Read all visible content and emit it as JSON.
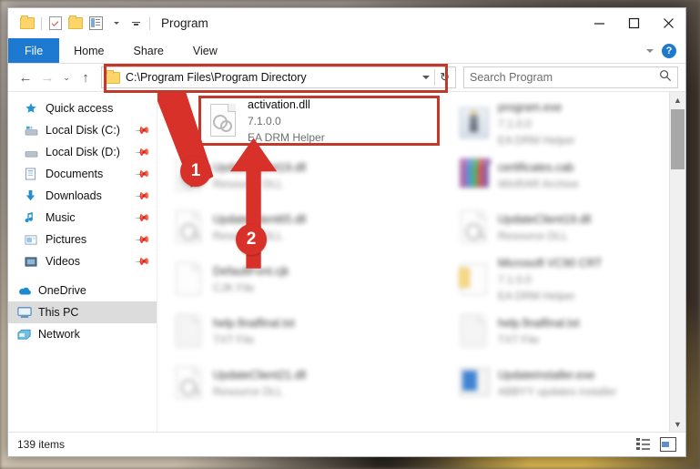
{
  "window": {
    "title": "Program",
    "quick_access": [
      "folder-icon",
      "properties-checkbox-icon",
      "new-folder-icon",
      "properties-icon",
      "customize-qat-icon"
    ],
    "controls": {
      "minimize": "minimize-icon",
      "maximize": "maximize-icon",
      "close": "close-icon"
    }
  },
  "ribbon": {
    "tabs": [
      {
        "label": "File",
        "active": true
      },
      {
        "label": "Home",
        "active": false
      },
      {
        "label": "Share",
        "active": false
      },
      {
        "label": "View",
        "active": false
      }
    ],
    "collapse_icon": "chevron-down-icon",
    "help_label": "?"
  },
  "addressbar": {
    "back": "back-arrow-icon",
    "forward": "forward-arrow-icon",
    "recent": "chevron-down-icon",
    "up": "up-arrow-icon",
    "path": "C:\\Program Files\\Program Directory",
    "dropdown": "chevron-down-icon",
    "refresh": "↻",
    "highlight_color": "#c0392b"
  },
  "search": {
    "placeholder": "Search Program",
    "icon": "search-icon"
  },
  "sidebar": {
    "items": [
      {
        "label": "Quick access",
        "icon": "star-icon",
        "pinned": false,
        "selected": false,
        "group": "top"
      },
      {
        "label": "Local Disk (C:)",
        "icon": "drive-icon",
        "pinned": true,
        "selected": false,
        "group": "top"
      },
      {
        "label": "Local Disk (D:)",
        "icon": "drive-icon",
        "pinned": true,
        "selected": false,
        "group": "top"
      },
      {
        "label": "Documents",
        "icon": "documents-icon",
        "pinned": true,
        "selected": false,
        "group": "top"
      },
      {
        "label": "Downloads",
        "icon": "downloads-icon",
        "pinned": true,
        "selected": false,
        "group": "top"
      },
      {
        "label": "Music",
        "icon": "music-icon",
        "pinned": true,
        "selected": false,
        "group": "top"
      },
      {
        "label": "Pictures",
        "icon": "pictures-icon",
        "pinned": true,
        "selected": false,
        "group": "top"
      },
      {
        "label": "Videos",
        "icon": "videos-icon",
        "pinned": true,
        "selected": false,
        "group": "top"
      },
      {
        "label": "OneDrive",
        "icon": "onedrive-icon",
        "pinned": false,
        "selected": false,
        "group": "root"
      },
      {
        "label": "This PC",
        "icon": "this-pc-icon",
        "pinned": false,
        "selected": true,
        "group": "root"
      },
      {
        "label": "Network",
        "icon": "network-icon",
        "pinned": false,
        "selected": false,
        "group": "root"
      }
    ]
  },
  "files": {
    "selected": {
      "name": "activation.dll",
      "version": "7.1.0.0",
      "description": "EA DRM Helper",
      "icon": "gears-dll-icon"
    },
    "left_column": [
      {
        "name": "UpdateClient19.dll",
        "meta": "Resource DLL",
        "icon": "wrench-dll-icon"
      },
      {
        "name": "UpdateClient65.dll",
        "meta": "Resource DLL",
        "icon": "wrench-dll-icon"
      },
      {
        "name": "DefaultFont.cjk",
        "meta": "CJK File",
        "icon": "blank-document-icon"
      },
      {
        "name": "help.finalfinal.txt",
        "meta": "TXT File",
        "icon": "text-document-icon"
      },
      {
        "name": "UpdateClient21.dll",
        "meta": "Resource DLL",
        "icon": "wrench-dll-icon"
      }
    ],
    "right_column": [
      {
        "name": "program.exe",
        "meta": "7.1.0.0",
        "meta2": "EA DRM Helper",
        "icon": "executable-icon"
      },
      {
        "name": "certificates.cab",
        "meta": "WinRAR Archive",
        "icon": "winrar-archive-icon"
      },
      {
        "name": "UpdateClient19.dll",
        "meta": "Resource DLL",
        "icon": "wrench-dll-icon"
      },
      {
        "name": "Microsoft VC90 CRT",
        "meta": "7.1.0.0",
        "meta2": "EA DRM Helper",
        "icon": "folder-document-icon"
      },
      {
        "name": "help.finalfinal.txt",
        "meta": "TXT File",
        "icon": "text-document-icon"
      },
      {
        "name": "Updateinstaller.exe",
        "meta": "ABBYY updates installer",
        "icon": "installer-icon"
      }
    ]
  },
  "annotations": [
    {
      "number": "1",
      "color": "#d8312a"
    },
    {
      "number": "2",
      "color": "#d8312a"
    }
  ],
  "status": {
    "item_count": "139 items",
    "view_details_icon": "details-view-icon",
    "view_thumbnails_icon": "thumbnail-view-icon"
  },
  "scrollbar": {
    "up": "scroll-up-icon",
    "down": "scroll-down-icon",
    "thumb": "scroll-thumb"
  }
}
